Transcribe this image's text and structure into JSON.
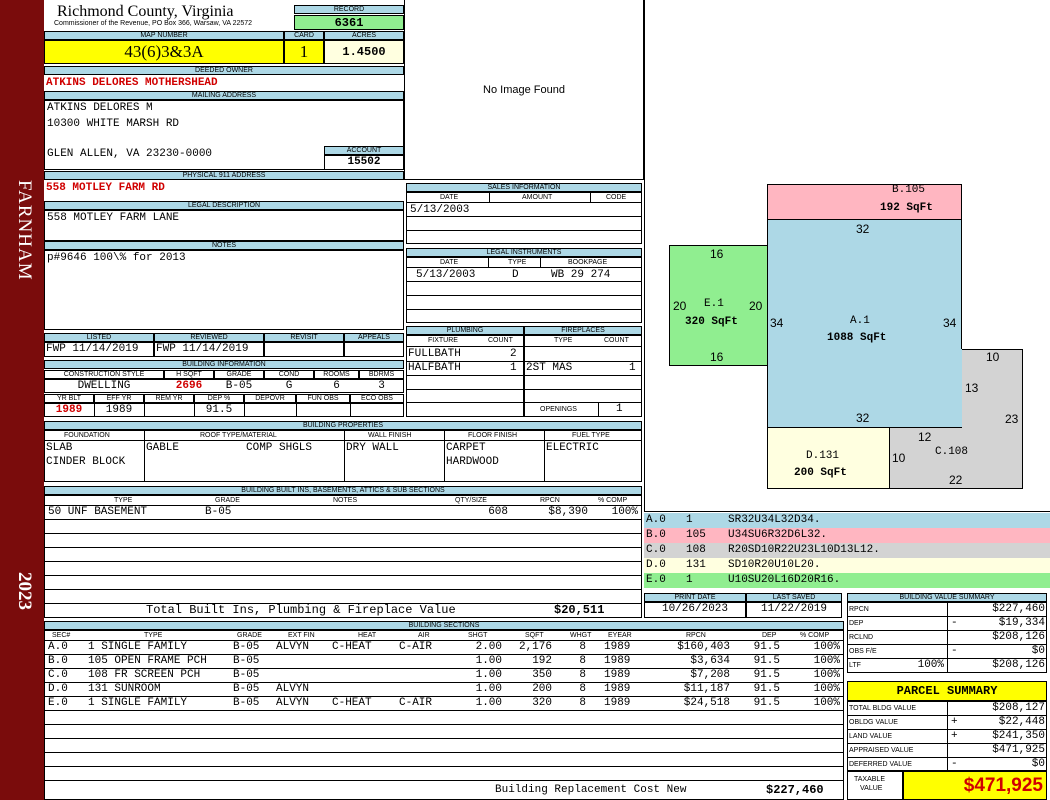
{
  "sidebar": {
    "district": "FARNHAM",
    "year": "2023"
  },
  "header": {
    "county": "Richmond County, Virginia",
    "commissioner": "Commissioner of the Revenue, PO Box 366, Warsaw, VA 22572",
    "record_label": "RECORD",
    "record": "6361",
    "map_label": "MAP NUMBER",
    "map_number": "43(6)3&3A",
    "card_label": "CARD",
    "card": "1",
    "acres_label": "ACRES",
    "acres": "1.4500"
  },
  "owner": {
    "deeded_label": "DEEDED OWNER",
    "deeded_owner": "ATKINS DELORES MOTHERSHEAD",
    "mailing_label": "MAILING ADDRESS",
    "mail_line1": "ATKINS DELORES M",
    "mail_line2": "10300 WHITE MARSH RD",
    "mail_line3": "GLEN ALLEN, VA 23230-0000",
    "account_label": "ACCOUNT",
    "account": "15502",
    "physical_label": "PHYSICAL 911 ADDRESS",
    "physical_address": "558 MOTLEY FARM RD",
    "legal_label": "LEGAL DESCRIPTION",
    "legal_description": "558 MOTLEY FARM LANE",
    "notes_label": "NOTES",
    "notes": "p#9646 100\\% for 2013"
  },
  "image": {
    "placeholder": "No Image Found"
  },
  "sales": {
    "title": "SALES INFORMATION",
    "col_date": "DATE",
    "col_amount": "AMOUNT",
    "col_code": "CODE",
    "date": "5/13/2003"
  },
  "legal_instruments": {
    "title": "LEGAL INSTRUMENTS",
    "col_date": "DATE",
    "col_type": "TYPE",
    "col_book": "BOOKPAGE",
    "date": "5/13/2003",
    "type": "D",
    "book": "WB 29 274"
  },
  "review": {
    "listed_label": "LISTED",
    "listed": "FWP 11/14/2019",
    "reviewed_label": "REVIEWED",
    "reviewed": "FWP 11/14/2019",
    "revisit_label": "REVISIT",
    "appeals_label": "APPEALS"
  },
  "building_info": {
    "title": "BUILDING INFORMATION",
    "construction_label": "CONSTRUCTION STYLE",
    "construction": "DWELLING",
    "hsqft_label": "H SQFT",
    "hsqft": "2696",
    "grade_label": "GRADE",
    "grade": "B-05",
    "cond_label": "COND",
    "cond": "G",
    "rooms_label": "ROOMS",
    "rooms": "6",
    "bdrms_label": "BDRMS",
    "bdrms": "3",
    "yrblt_label": "YR BLT",
    "yrblt": "1989",
    "effyr_label": "EFF YR",
    "effyr": "1989",
    "remyr_label": "REM YR",
    "dep_label": "DEP %",
    "dep": "91.5",
    "depovr_label": "DEPOVR",
    "funobs_label": "FUN OBS",
    "ecoobs_label": "ECO OBS"
  },
  "plumbing": {
    "title": "PLUMBING",
    "col_fixture": "FIXTURE",
    "col_count": "COUNT",
    "rows": [
      {
        "fixture": "FULLBATH",
        "count": "2"
      },
      {
        "fixture": "HALFBATH",
        "count": "1"
      }
    ]
  },
  "fireplaces": {
    "title": "FIREPLACES",
    "col_type": "TYPE",
    "col_count": "COUNT",
    "type": "2ST MAS",
    "count": "1",
    "openings_label": "OPENINGS",
    "openings": "1"
  },
  "properties": {
    "title": "BUILDING PROPERTIES",
    "foundation_label": "FOUNDATION",
    "foundation1": "SLAB",
    "foundation2": "CINDER BLOCK",
    "roof_label": "ROOF TYPE/MATERIAL",
    "roof_type": "GABLE",
    "roof_material": "COMP SHGLS",
    "wall_label": "WALL FINISH",
    "wall": "DRY WALL",
    "floor_label": "FLOOR FINISH",
    "floor1": "CARPET",
    "floor2": "HARDWOOD",
    "fuel_label": "FUEL TYPE",
    "fuel": "ELECTRIC"
  },
  "builtins": {
    "title": "BUILDING BUILT INS, BASEMENTS, ATTICS & SUB SECTIONS",
    "col_type": "TYPE",
    "col_grade": "GRADE",
    "col_notes": "NOTES",
    "col_qty": "QTY/SIZE",
    "col_rpcn": "RPCN",
    "col_comp": "% COMP",
    "row": {
      "type": "50 UNF BASEMENT",
      "grade": "B-05",
      "qty": "608",
      "rpcn": "$8,390",
      "comp": "100%"
    },
    "total_label": "Total Built Ins, Plumbing & Fireplace Value",
    "total": "$20,511"
  },
  "sketch": {
    "areas": [
      {
        "id": "B.105",
        "sqft": "192 SqFt"
      },
      {
        "id": "A.1",
        "sqft": "1088 SqFt"
      },
      {
        "id": "E.1",
        "sqft": "320 SqFt"
      },
      {
        "id": "D.131",
        "sqft": "200 SqFt"
      },
      {
        "id": "C.108",
        "sqft": ""
      }
    ],
    "dims": {
      "a_top": "32",
      "a_left": "34",
      "a_right": "34",
      "a_bottom": "32",
      "e_top": "16",
      "e_left": "20",
      "e_right": "20",
      "e_bottom": "16",
      "c_top": "10",
      "c_left": "13",
      "c_right": "23",
      "c_bottom": "22",
      "c_in": "12",
      "d_right": "10"
    },
    "colors": {
      "A": "#add8e6",
      "B": "#ffb6c1",
      "C": "#d3d3d3",
      "D": "#ffffe0",
      "E": "#90ee90"
    }
  },
  "vectors": [
    {
      "id": "A.0",
      "num": "1",
      "code": "SR32U34L32D34."
    },
    {
      "id": "B.0",
      "num": "105",
      "code": "U34SU6R32D6L32."
    },
    {
      "id": "C.0",
      "num": "108",
      "code": "R20SD10R22U23L10D13L12."
    },
    {
      "id": "D.0",
      "num": "131",
      "code": "SD10R20U10L20."
    },
    {
      "id": "E.0",
      "num": "1",
      "code": "U10SU20L16D20R16."
    }
  ],
  "dates": {
    "print_label": "PRINT DATE",
    "print": "10/26/2023",
    "saved_label": "LAST SAVED",
    "saved": "11/22/2019"
  },
  "bvs": {
    "title": "BUILDING VALUE SUMMARY",
    "rows": [
      {
        "label": "RPCN",
        "sign": "",
        "pct": "",
        "value": "$227,460"
      },
      {
        "label": "DEP",
        "sign": "-",
        "pct": "",
        "value": "$19,334"
      },
      {
        "label": "RCLND",
        "sign": "",
        "pct": "",
        "value": "$208,126"
      },
      {
        "label": "OBS F/E",
        "sign": "-",
        "pct": "",
        "value": "$0"
      },
      {
        "label": "LTF",
        "sign": "",
        "pct": "100%",
        "value": "$208,126"
      }
    ]
  },
  "parcel": {
    "title": "PARCEL SUMMARY",
    "rows": [
      {
        "label": "TOTAL BLDG VALUE",
        "sign": "",
        "value": "$208,127"
      },
      {
        "label": "OBLDG VALUE",
        "sign": "+",
        "value": "$22,448"
      },
      {
        "label": "LAND VALUE",
        "sign": "+",
        "value": "$241,350"
      },
      {
        "label": "APPRAISED VALUE",
        "sign": "",
        "value": "$471,925"
      },
      {
        "label": "DEFERRED VALUE",
        "sign": "-",
        "value": "$0"
      }
    ],
    "taxable_label1": "TAXABLE",
    "taxable_label2": "VALUE",
    "taxable": "$471,925"
  },
  "sections": {
    "title": "BUILDING SECTIONS",
    "headers": [
      "SEC#",
      "TYPE",
      "GRADE",
      "EXT FIN",
      "HEAT",
      "AIR",
      "SHGT",
      "SQFT",
      "WHGT",
      "EYEAR",
      "RPCN",
      "DEP",
      "% COMP"
    ],
    "rows": [
      {
        "sec": "A.0",
        "type": "1 SINGLE FAMILY",
        "grade": "B-05",
        "ext": "ALVYN",
        "heat": "C-HEAT",
        "air": "C-AIR",
        "shgt": "2.00",
        "sqft": "2,176",
        "whgt": "8",
        "eyear": "1989",
        "rpcn": "$160,403",
        "dep": "91.5",
        "comp": "100%"
      },
      {
        "sec": "B.0",
        "type": "105 OPEN FRAME PCH",
        "grade": "B-05",
        "ext": "",
        "heat": "",
        "air": "",
        "shgt": "1.00",
        "sqft": "192",
        "whgt": "8",
        "eyear": "1989",
        "rpcn": "$3,634",
        "dep": "91.5",
        "comp": "100%"
      },
      {
        "sec": "C.0",
        "type": "108 FR SCREEN PCH",
        "grade": "B-05",
        "ext": "",
        "heat": "",
        "air": "",
        "shgt": "1.00",
        "sqft": "350",
        "whgt": "8",
        "eyear": "1989",
        "rpcn": "$7,208",
        "dep": "91.5",
        "comp": "100%"
      },
      {
        "sec": "D.0",
        "type": "131 SUNROOM",
        "grade": "B-05",
        "ext": "ALVYN",
        "heat": "",
        "air": "",
        "shgt": "1.00",
        "sqft": "200",
        "whgt": "8",
        "eyear": "1989",
        "rpcn": "$11,187",
        "dep": "91.5",
        "comp": "100%"
      },
      {
        "sec": "E.0",
        "type": "1 SINGLE FAMILY",
        "grade": "B-05",
        "ext": "ALVYN",
        "heat": "C-HEAT",
        "air": "C-AIR",
        "shgt": "1.00",
        "sqft": "320",
        "whgt": "8",
        "eyear": "1989",
        "rpcn": "$24,518",
        "dep": "91.5",
        "comp": "100%"
      }
    ],
    "footer_label": "Building Replacement Cost New",
    "footer_value": "$227,460"
  }
}
